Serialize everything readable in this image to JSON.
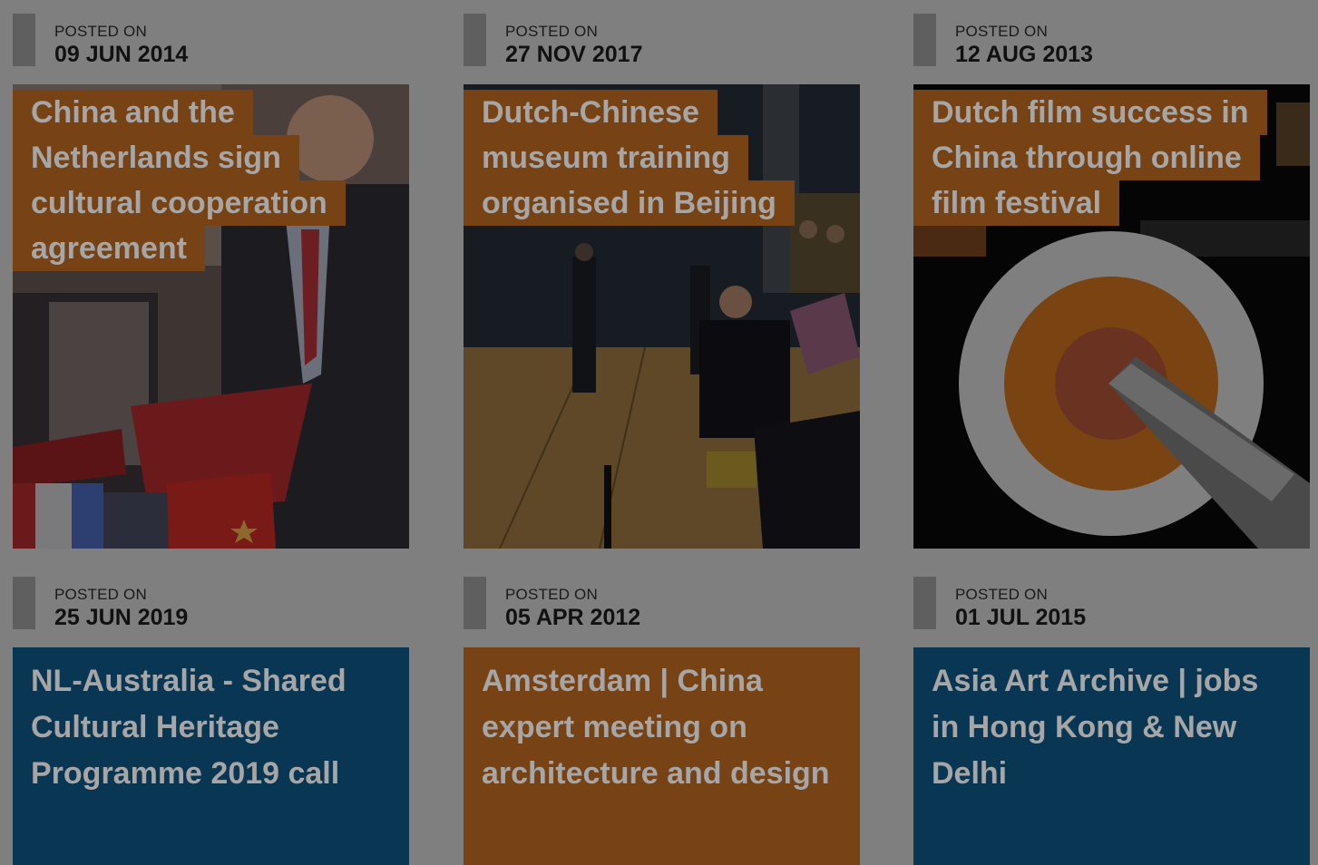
{
  "posted_label": "POSTED ON",
  "colors": {
    "overlay_bg": "#7f7f7f",
    "brown": "#774315",
    "blue": "#093652",
    "text_muted": "#a6a6a6"
  },
  "cards": [
    {
      "date": "09 JUN 2014",
      "title_lines": [
        "China and the",
        "Netherlands sign",
        "cultural cooperation",
        "agreement"
      ],
      "image": "signing-ceremony-photo"
    },
    {
      "date": "27 NOV 2017",
      "title_lines": [
        "Dutch-Chinese",
        "museum training",
        "organised in Beijing"
      ],
      "image": "museum-gallery-photo"
    },
    {
      "date": "12 AUG 2013",
      "title_lines": [
        "Dutch film success in",
        "China through online",
        "film festival"
      ],
      "image": "film-festival-poster"
    },
    {
      "date": "25 JUN 2019",
      "title": "NL-Australia - Shared Cultural Heritage Programme 2019 call"
    },
    {
      "date": "05 APR 2012",
      "title": "Amsterdam | China expert meeting on architecture and design"
    },
    {
      "date": "01 JUL 2015",
      "title": "Asia Art Archive | jobs in Hong Kong & New Delhi"
    }
  ]
}
